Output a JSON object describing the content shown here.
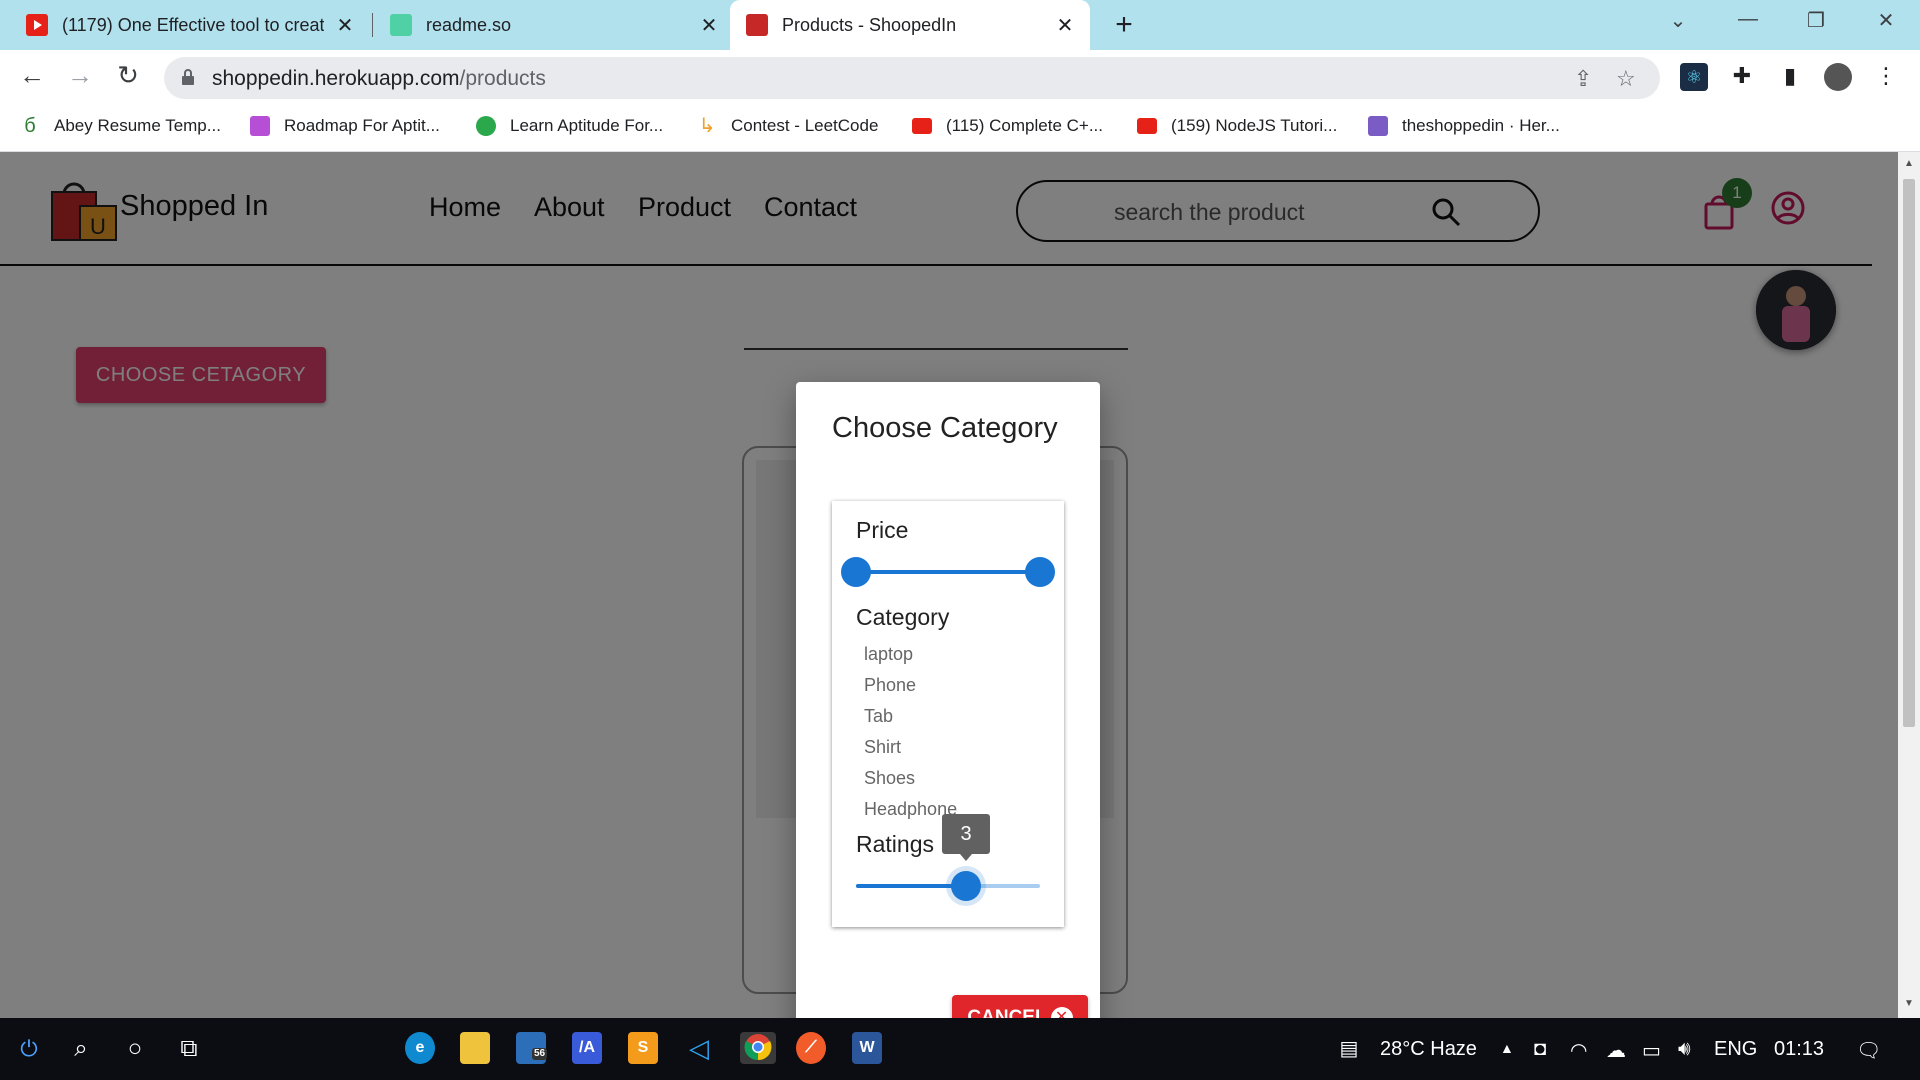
{
  "browser": {
    "tabs": [
      {
        "title": "(1179) One Effective tool to creat",
        "favicon": "youtube-icon",
        "active": false
      },
      {
        "title": "readme.so",
        "favicon": "readme-icon",
        "active": false
      },
      {
        "title": "Products - ShoopedIn",
        "favicon": "shopping-bag-icon",
        "active": true
      }
    ],
    "address": {
      "domain": "shoppedin.herokuapp.com",
      "path": "/products"
    },
    "bookmarks": [
      {
        "label": "Abey Resume Temp...",
        "icon": "leaf-icon"
      },
      {
        "label": "Roadmap For Aptit...",
        "icon": "roadmap-icon"
      },
      {
        "label": "Learn Aptitude For...",
        "icon": "hexagon-icon"
      },
      {
        "label": "Contest - LeetCode",
        "icon": "leetcode-icon"
      },
      {
        "label": "(115) Complete C+...",
        "icon": "youtube-icon"
      },
      {
        "label": "(159) NodeJS Tutori...",
        "icon": "youtube-icon"
      },
      {
        "label": "theshoppedin · Her...",
        "icon": "heroku-icon"
      }
    ]
  },
  "site": {
    "brand": "Shopped In",
    "nav": [
      "Home",
      "About",
      "Product",
      "Contact"
    ],
    "search_placeholder": "search the product",
    "cart_count": "1",
    "choose_button": "CHOOSE CETAGORY"
  },
  "dialog": {
    "title": "Choose Category",
    "price_label": "Price",
    "category_label": "Category",
    "categories": [
      "laptop",
      "Phone",
      "Tab",
      "Shirt",
      "Shoes",
      "Headphone"
    ],
    "ratings_label": "Ratings",
    "ratings_value": "3",
    "ratings_fraction": 0.6,
    "price_range_fraction": [
      0,
      1
    ],
    "cancel_label": "CANCEL"
  },
  "taskbar": {
    "weather": "28°C  Haze",
    "language": "ENG",
    "time": "01:13",
    "mail_badge": "56"
  },
  "colors": {
    "accent_blue": "#1976d2",
    "cancel_red": "#e0262a",
    "choose_pink": "#e4406f",
    "tabstrip": "#b2e1ee"
  }
}
